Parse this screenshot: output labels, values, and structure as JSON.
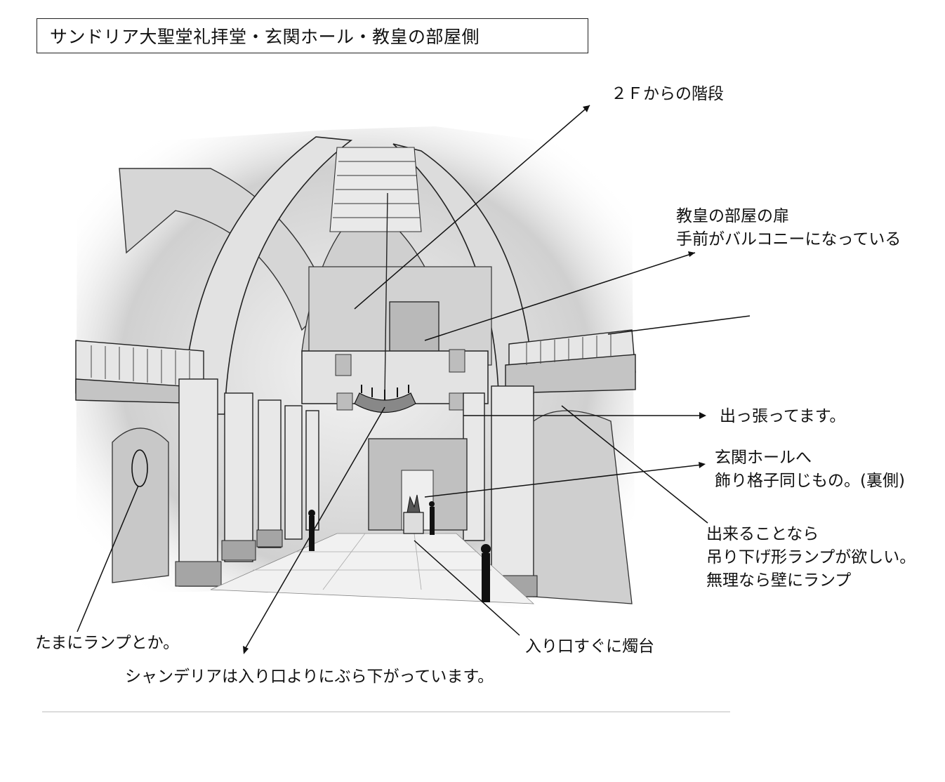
{
  "title": "サンドリア大聖堂礼拝堂・玄関ホール・教皇の部屋側",
  "annotations": {
    "stairs": "２Ｆからの階段",
    "pope_door_line1": "教皇の部屋の扉",
    "pope_door_line2": "手前がバルコニーになっている",
    "protrude": "出っ張ってます。",
    "hall_line1": "玄関ホールへ",
    "hall_line2": "飾り格子同じもの。(裏側)",
    "lamp_line1": "出来ることなら",
    "lamp_line2": "吊り下げ形ランプが欲しい。",
    "lamp_line3": "無理なら壁にランプ",
    "wall_lamp": "たまにランプとか。",
    "candle": "入り口すぐに燭台",
    "chandelier": "シャンデリアは入り口よりにぶら下がっています。"
  },
  "colors": {
    "ink": "#1a1a1a",
    "wash_dark": "#a9a9a9",
    "wash_mid": "#c9c9c9",
    "wash_light": "#e6e6e6",
    "paper": "#ffffff"
  }
}
